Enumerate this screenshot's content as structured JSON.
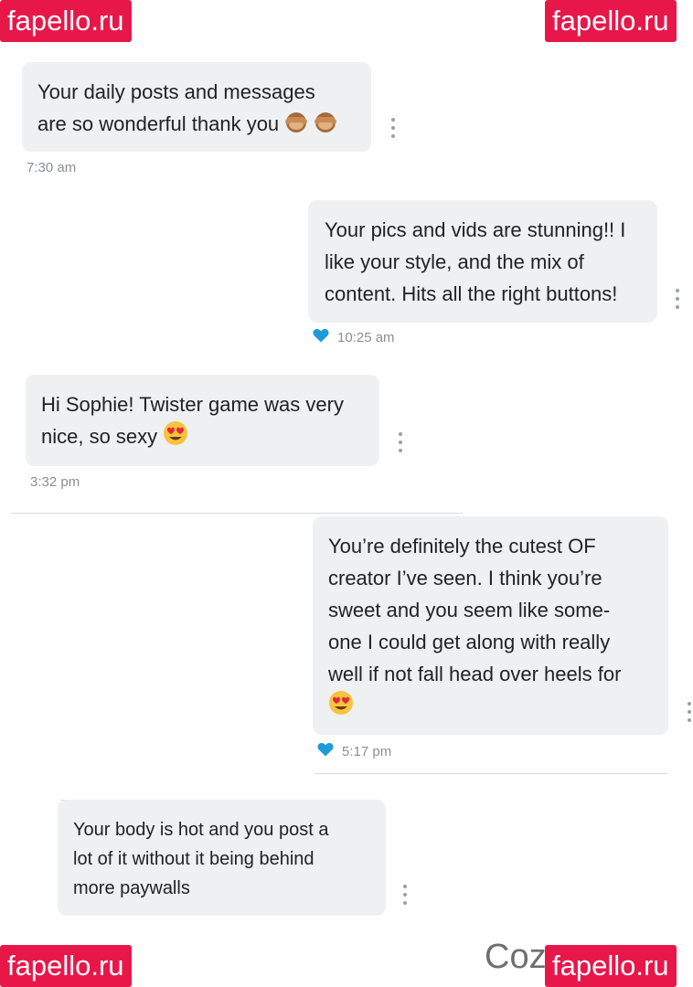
{
  "watermark": "fapello.ru",
  "background_text": "Coz",
  "messages": [
    {
      "text": "Your daily posts and messages\nare so wonderful thank you",
      "emojis": [
        "see-no-evil-monkey",
        "see-no-evil-monkey"
      ],
      "time": "7:30 am",
      "liked": false
    },
    {
      "text": "Your pics and vids are stunning!! I\nlike your style, and the mix of\ncontent. Hits all the right buttons!",
      "emojis": [],
      "time": "10:25 am",
      "liked": true
    },
    {
      "text": "Hi Sophie! Twister game was very\nnice, so sexy",
      "emojis": [
        "heart-eyes"
      ],
      "time": "3:32 pm",
      "liked": false
    },
    {
      "text": "You’re definitely the cutest OF\ncreator I’ve seen. I think you’re\nsweet and you seem like some-\none I could get along with really\nwell if not fall head over heels for",
      "emojis": [
        "heart-eyes"
      ],
      "time": "5:17 pm",
      "liked": true
    },
    {
      "text": "Your body is hot and you post a\nlot of it without it being behind\nmore paywalls",
      "emojis": [],
      "time": "",
      "liked": false
    }
  ],
  "colors": {
    "bubble": "#eef0f1",
    "watermark": "#e8174a",
    "heart": "#1f9bd7",
    "time": "#8a8f93"
  }
}
